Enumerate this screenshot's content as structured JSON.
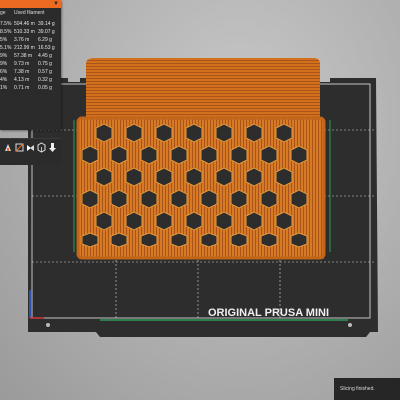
{
  "stats_panel": {
    "accent_color": "#ed6b21",
    "header": {
      "col1": "ge",
      "col2": "Used filament"
    },
    "rows": [
      {
        "pct": "7.5%",
        "length": "504.46 m",
        "weight": "39.14 g"
      },
      {
        "pct": "8.5%",
        "length": "510.33 m",
        "weight": "39.07 g"
      },
      {
        "pct": "5%",
        "length": "3.76 m",
        "weight": "6.29 g"
      },
      {
        "pct": "5.1%",
        "length": "212.99 m",
        "weight": "16.53 g"
      },
      {
        "pct": "9%",
        "length": "57.38 m",
        "weight": "4.45 g"
      },
      {
        "pct": "9%",
        "length": "9.73 m",
        "weight": "0.75 g"
      },
      {
        "pct": "6%",
        "length": "7.38 m",
        "weight": "0.57 g"
      },
      {
        "pct": "4%",
        "length": "4.13 m",
        "weight": "0.32 g"
      },
      {
        "pct": "1%",
        "length": "0.71 m",
        "weight": "0.05 g"
      }
    ]
  },
  "toolbar": {
    "icons": [
      "move-icon",
      "rotate-icon",
      "scale-icon",
      "view-icon",
      "export-icon"
    ]
  },
  "bed": {
    "label": "ORIGINAL PRUSA MINI",
    "bed_color": "#2d2d2d",
    "print_color": "#d2701c",
    "outline_color": "#2f9a58"
  },
  "status": {
    "message": "Slicing finished."
  }
}
